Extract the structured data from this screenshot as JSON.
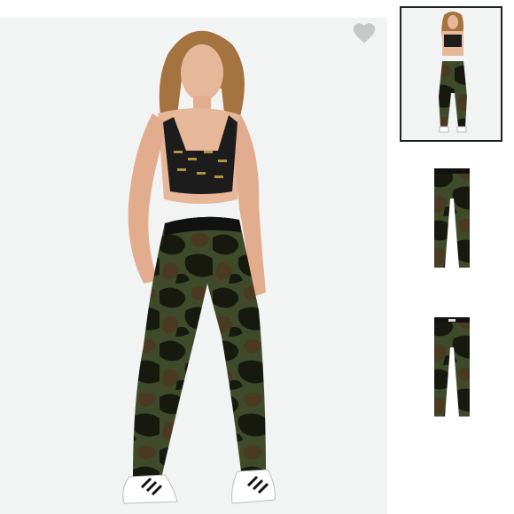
{
  "gallery": {
    "favorite": {
      "icon": "heart-icon",
      "color": "#c8c8c8"
    },
    "main_image": {
      "description_icon": "product-photo-model-camo-leggings"
    },
    "thumbnails": [
      {
        "icon": "model-thumbnail",
        "selected": true
      },
      {
        "icon": "leggings-front-thumbnail",
        "selected": false
      },
      {
        "icon": "leggings-back-thumbnail",
        "selected": false
      }
    ]
  },
  "colors": {
    "background": "#f2f3f3",
    "camo_dark": "#1a1d14",
    "camo_olive": "#3e4a2a",
    "camo_brown": "#4a3a22",
    "selected_border": "#222222"
  }
}
